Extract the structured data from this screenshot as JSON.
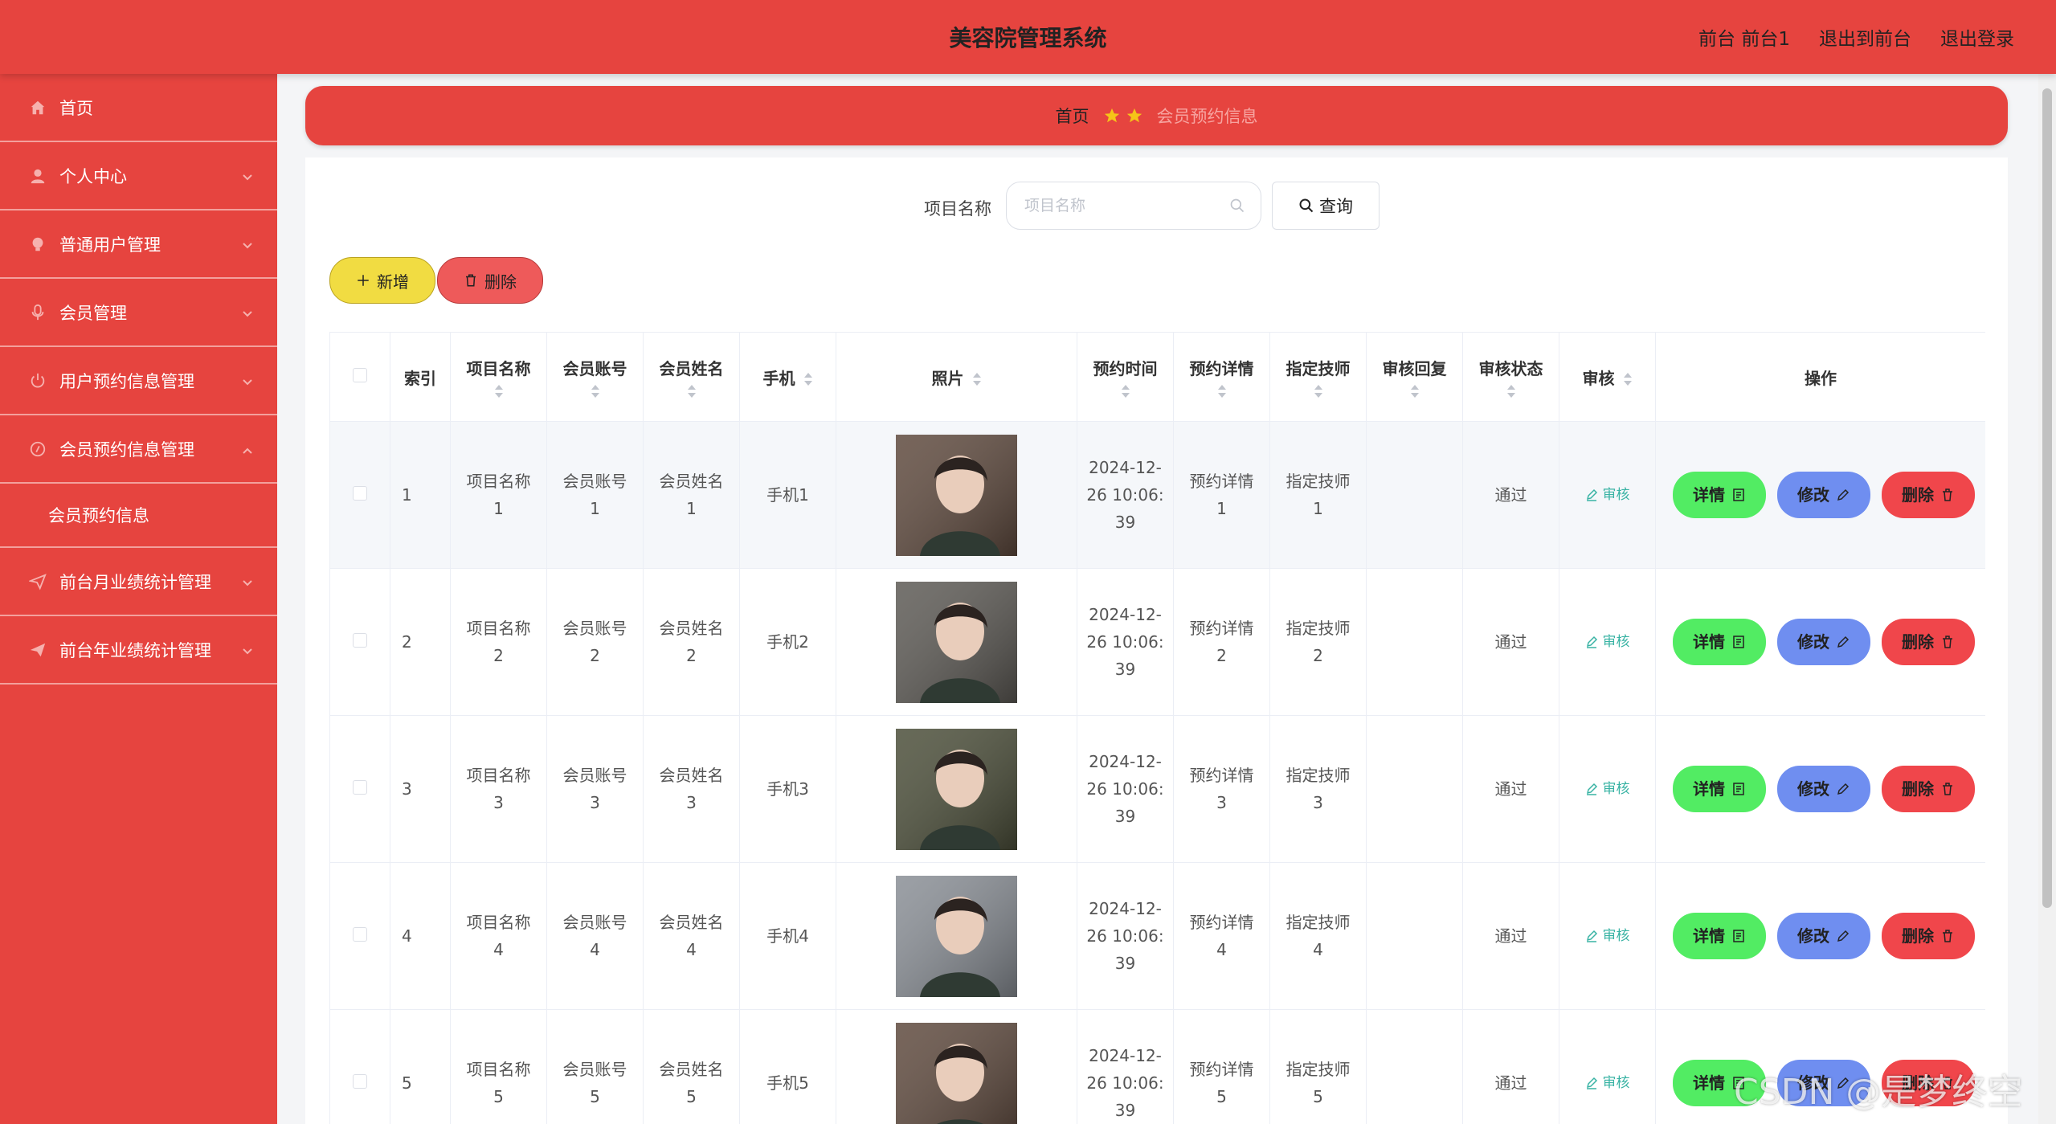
{
  "header": {
    "title": "美容院管理系统",
    "links": [
      "前台 前台1",
      "退出到前台",
      "退出登录"
    ]
  },
  "sidebar": {
    "items": [
      {
        "label": "首页",
        "icon": "home-icon",
        "has_arrow": false
      },
      {
        "label": "个人中心",
        "icon": "user-icon",
        "has_arrow": true
      },
      {
        "label": "普通用户管理",
        "icon": "bulb-icon",
        "has_arrow": true
      },
      {
        "label": "会员管理",
        "icon": "mic-icon",
        "has_arrow": true
      },
      {
        "label": "用户预约信息管理",
        "icon": "power-icon",
        "has_arrow": true
      },
      {
        "label": "会员预约信息管理",
        "icon": "compass-icon",
        "has_arrow": true,
        "expanded": true
      },
      {
        "label": "前台月业绩统计管理",
        "icon": "send-icon",
        "has_arrow": true
      },
      {
        "label": "前台年业绩统计管理",
        "icon": "plane-icon",
        "has_arrow": true
      }
    ],
    "submenu": {
      "label": "会员预约信息"
    }
  },
  "breadcrumb": {
    "home": "首页",
    "current": "会员预约信息"
  },
  "search": {
    "label": "项目名称",
    "placeholder": "项目名称",
    "value": "",
    "button": "查询"
  },
  "actions": {
    "add": "新增",
    "delete": "删除"
  },
  "table": {
    "columns": [
      "索引",
      "项目名称",
      "会员账号",
      "会员姓名",
      "手机",
      "照片",
      "预约时间",
      "预约详情",
      "指定技师",
      "审核回复",
      "审核状态",
      "审核",
      "操作"
    ],
    "rows": [
      {
        "index": "1",
        "project": "项目名称\n1",
        "account": "会员账号\n1",
        "name": "会员姓名\n1",
        "phone": "手机1",
        "time": "2024-12-\n26 10:06:\n39",
        "detail": "预约详情\n1",
        "tech": "指定技师\n1",
        "reply": "",
        "status": "通过",
        "photo_color": "#5f4a3e"
      },
      {
        "index": "2",
        "project": "项目名称\n2",
        "account": "会员账号\n2",
        "name": "会员姓名\n2",
        "phone": "手机2",
        "time": "2024-12-\n26 10:06:\n39",
        "detail": "预约详情\n2",
        "tech": "指定技师\n2",
        "reply": "",
        "status": "通过",
        "photo_color": "#5d5a55"
      },
      {
        "index": "3",
        "project": "项目名称\n3",
        "account": "会员账号\n3",
        "name": "会员姓名\n3",
        "phone": "手机3",
        "time": "2024-12-\n26 10:06:\n39",
        "detail": "预约详情\n3",
        "tech": "指定技师\n3",
        "reply": "",
        "status": "通过",
        "photo_color": "#4c4f3a"
      },
      {
        "index": "4",
        "project": "项目名称\n4",
        "account": "会员账号\n4",
        "name": "会员姓名\n4",
        "phone": "手机4",
        "time": "2024-12-\n26 10:06:\n39",
        "detail": "预约详情\n4",
        "tech": "指定技师\n4",
        "reply": "",
        "status": "通过",
        "photo_color": "#8a8f96"
      },
      {
        "index": "5",
        "project": "项目名称\n5",
        "account": "会员账号\n5",
        "name": "会员姓名\n5",
        "phone": "手机5",
        "time": "2024-12-\n26 10:06:\n39",
        "detail": "预约详情\n5",
        "tech": "指定技师\n5",
        "reply": "",
        "status": "通过",
        "photo_color": "#5f4a3e"
      }
    ],
    "audit_label": "审核",
    "op_labels": {
      "detail": "详情",
      "edit": "修改",
      "remove": "删除"
    }
  },
  "watermark": "CSDN @是梦终空",
  "colors": {
    "brand": "#e6443f",
    "add": "#f1dc42",
    "delete": "#ee5a5a",
    "detail": "#52ec63",
    "edit": "#6f8ef0",
    "remove": "#f0464b",
    "audit": "#39b3a4"
  }
}
